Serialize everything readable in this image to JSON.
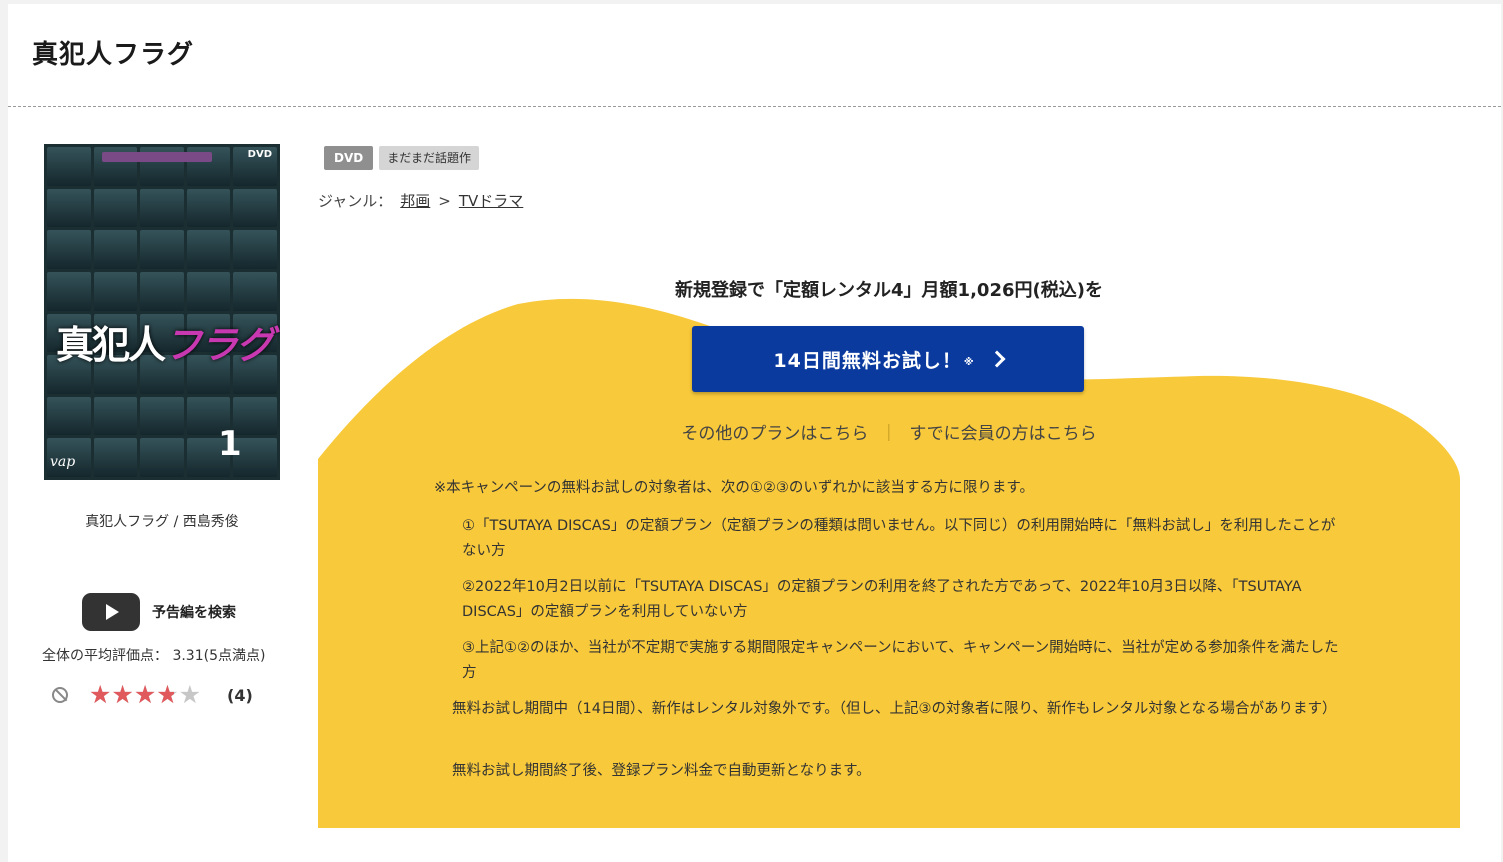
{
  "title": "真犯人フラグ",
  "cover": {
    "title_main": "真犯人",
    "title_accent": "フラグ",
    "disc_label": "DVD",
    "volume": "1",
    "label_logo": "vap"
  },
  "caption": "真犯人フラグ / 西島秀俊",
  "trailer_label": "予告編を検索",
  "rating": {
    "average_text": "全体の平均評価点： 3.31(5点満点)",
    "value": 3.31,
    "max": 5,
    "stars_glyphs": "★★★★★",
    "count": "(4)"
  },
  "badges": {
    "format": "DVD",
    "tag": "まだまだ話題作"
  },
  "genre": {
    "label": "ジャンル：",
    "level1": "邦画",
    "sep": ">",
    "level2": "TVドラマ"
  },
  "campaign": {
    "headline": "新規登録で「定額レンタル4」月額1,026円(税込)を",
    "cta_label": "14日間無料お試し！",
    "cta_mark": "※",
    "link_other_plans": "その他のプランはこちら",
    "link_separator": "｜",
    "link_members": "すでに会員の方はこちら",
    "note_head": "※本キャンペーンの無料お試しの対象者は、次の①②③のいずれかに該当する方に限ります。",
    "note_1": "①「TSUTAYA DISCAS」の定額プラン（定額プランの種類は問いません。以下同じ）の利用開始時に「無料お試し」を利用したことがない方",
    "note_2": "②2022年10月2日以前に「TSUTAYA DISCAS」の定額プランの利用を終了された方であって、2022年10月3日以降、「TSUTAYA DISCAS」の定額プランを利用していない方",
    "note_3": "③上記①②のほか、当社が不定期で実施する期間限定キャンペーンにおいて、キャンペーン開始時に、当社が定める参加条件を満たした方",
    "note_4": "無料お試し期間中（14日間）、新作はレンタル対象外です。（但し、上記③の対象者に限り、新作もレンタル対象となる場合があります）",
    "note_5": "無料お試し期間終了後、登録プラン料金で自動更新となります。"
  },
  "colors": {
    "cta": "#0a3a9e",
    "panel": "#f8c93a",
    "star": "#e0595d"
  }
}
